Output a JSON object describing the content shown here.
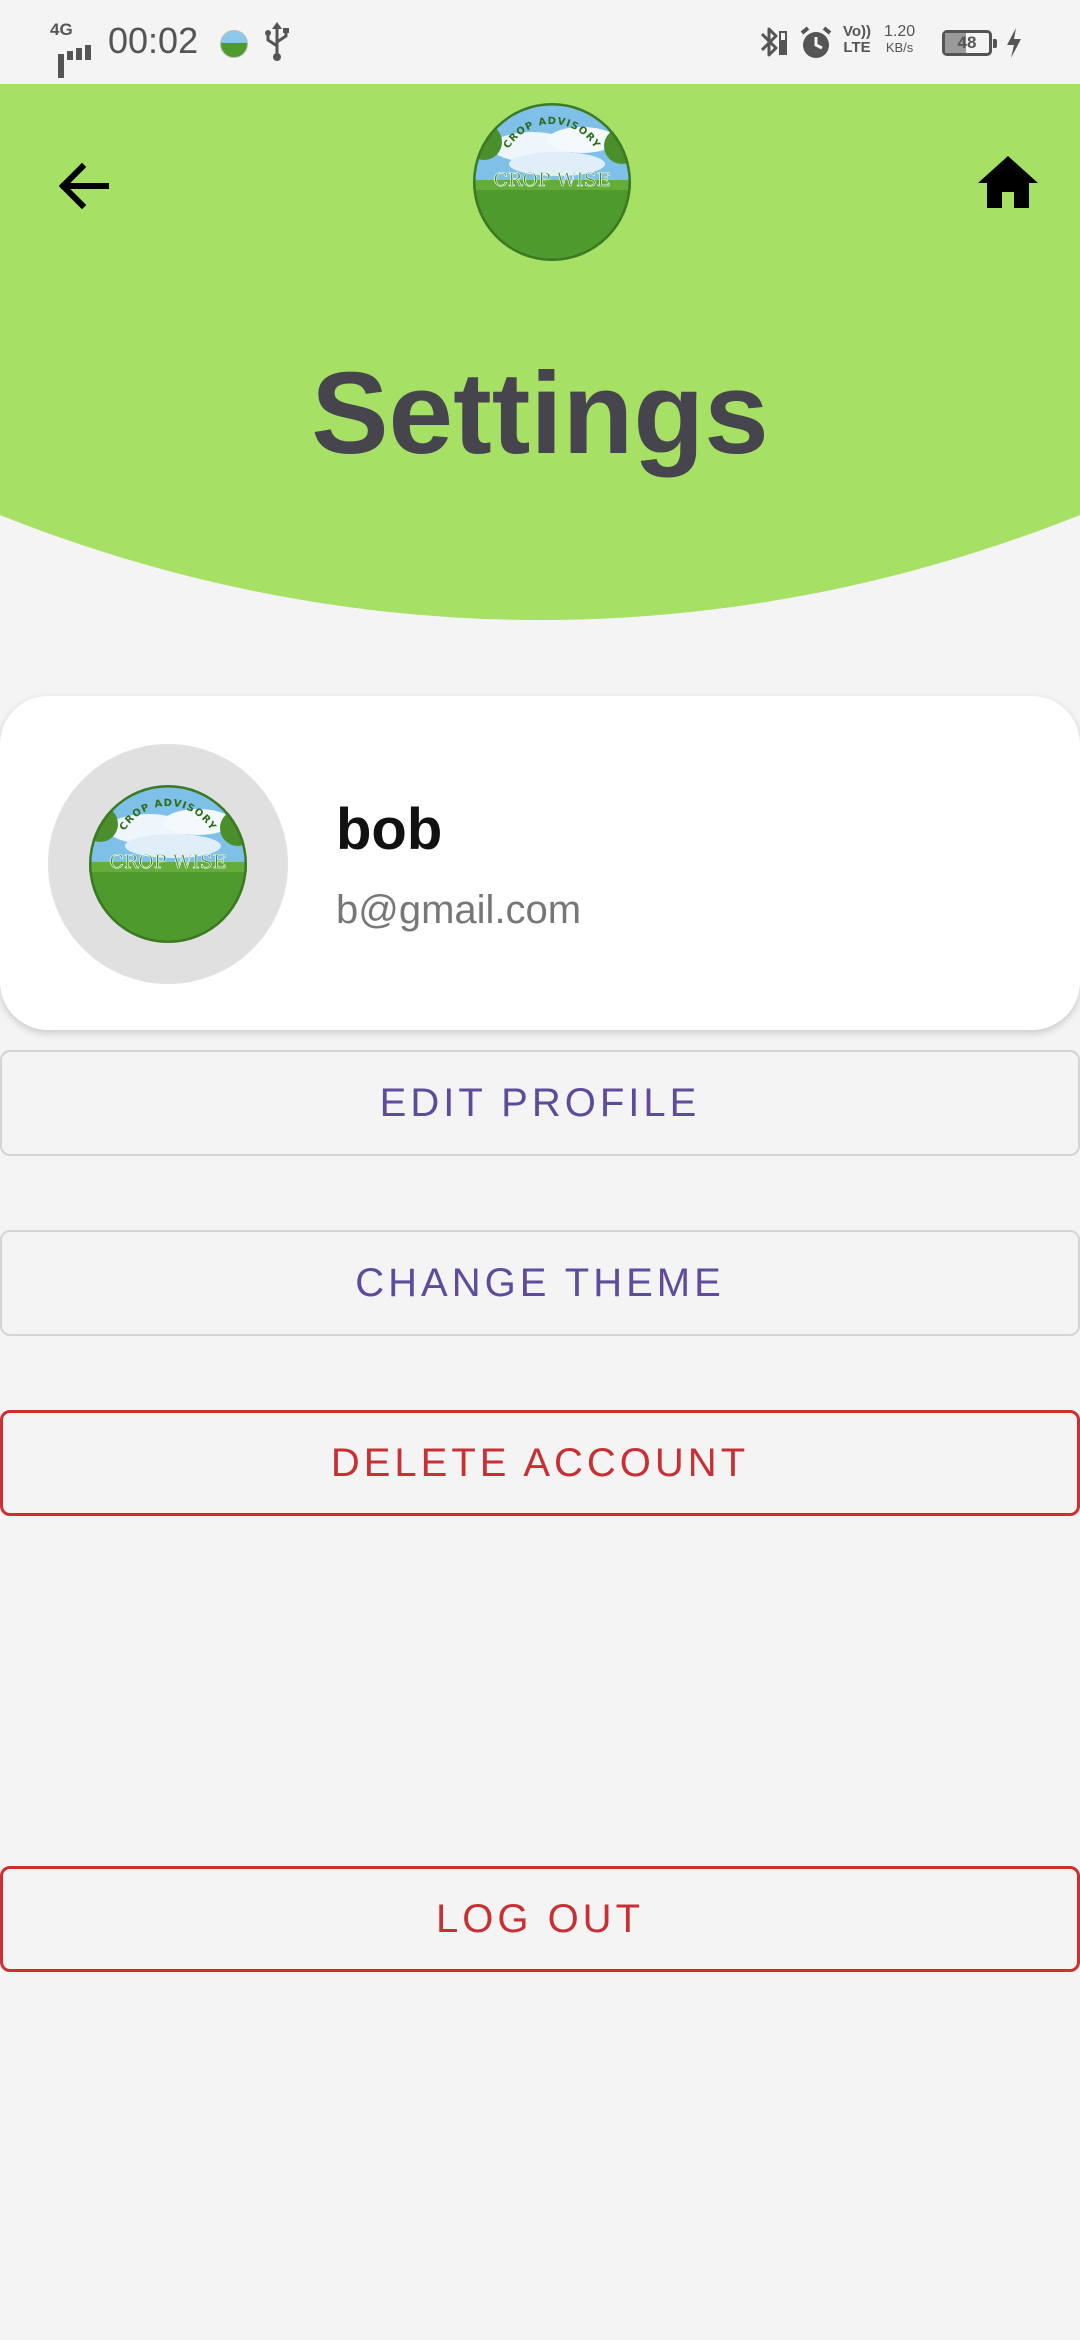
{
  "status_bar": {
    "network": "4G",
    "time": "00:02",
    "volte": "Vo)) LTE",
    "speed_value": "1.20",
    "speed_unit": "KB/s",
    "battery_level": "48",
    "icons": [
      "signal-icon",
      "app-notification-icon",
      "usb-icon",
      "bluetooth-icon",
      "alarm-icon",
      "volte-icon",
      "battery-icon",
      "charging-icon"
    ]
  },
  "header": {
    "title": "Settings",
    "back_icon": "arrow-left-icon",
    "home_icon": "home-icon",
    "logo_text_top": "CROP ADVISORY",
    "logo_text_main": "CROP WISE",
    "background_color": "#a6e064"
  },
  "profile": {
    "name": "bob",
    "email": "b@gmail.com"
  },
  "actions": {
    "edit_profile": "EDIT PROFILE",
    "change_theme": "CHANGE THEME",
    "delete_account": "DELETE ACCOUNT",
    "log_out": "LOG OUT"
  },
  "colors": {
    "accent_purple": "#5e4c9b",
    "danger_red": "#c73134",
    "title_gray": "#46454d"
  }
}
